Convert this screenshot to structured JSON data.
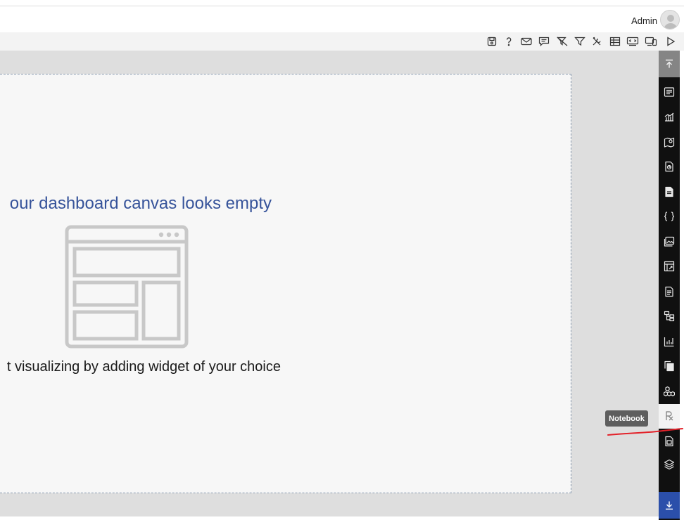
{
  "header": {
    "user_name": "Admin",
    "avatar_icon": "user-avatar-icon"
  },
  "toolbar": {
    "items": [
      {
        "name": "save-icon"
      },
      {
        "name": "help-icon"
      },
      {
        "name": "mail-icon"
      },
      {
        "name": "comment-icon"
      },
      {
        "name": "clear-filter-icon"
      },
      {
        "name": "filter-icon"
      },
      {
        "name": "tools-icon"
      },
      {
        "name": "table-icon"
      },
      {
        "name": "embed-icon"
      },
      {
        "name": "device-preview-icon"
      },
      {
        "name": "play-icon"
      }
    ]
  },
  "canvas": {
    "headline": "our dashboard canvas looks empty",
    "subline": "t visualizing by adding widget of your choice",
    "illustration": "dashboard-layout-illustration"
  },
  "widget_rail": {
    "top_button": "scroll-to-top-icon",
    "items": [
      "grid-widget-icon",
      "chart-widget-icon",
      "map-widget-icon",
      "report-widget-icon",
      "document-widget-icon",
      "code-widget-icon",
      "image-widget-icon",
      "frame-widget-icon",
      "file-widget-icon",
      "tree-widget-icon",
      "kpi-widget-icon",
      "copy-widget-icon",
      "cubes-widget-icon",
      "notebook-icon",
      "page-widget-icon",
      "layers-widget-icon"
    ],
    "bottom_button": "scroll-to-bottom-icon",
    "active_item": "notebook-icon",
    "tooltip": "Notebook"
  },
  "colors": {
    "headline": "#36539a",
    "rail": "#101010",
    "rail_bottom": "#2b4faa",
    "annotation": "#e3222a"
  }
}
